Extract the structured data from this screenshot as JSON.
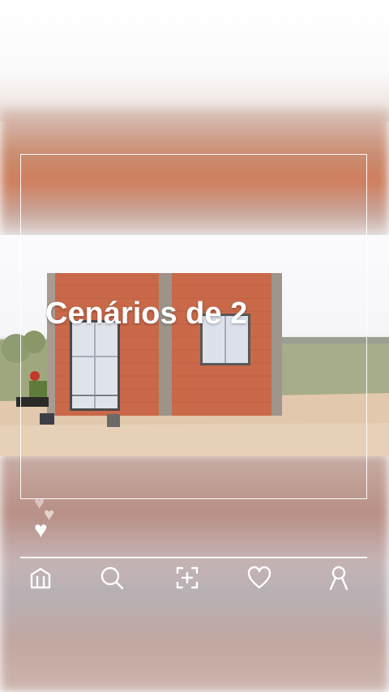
{
  "overlay": {
    "title": "Cenários de 2"
  },
  "reactions": {
    "heart_count_visible": 3
  },
  "nav": {
    "items": [
      {
        "name": "home",
        "icon": "home-icon"
      },
      {
        "name": "search",
        "icon": "search-icon"
      },
      {
        "name": "add",
        "icon": "add-media-icon"
      },
      {
        "name": "likes",
        "icon": "heart-icon"
      },
      {
        "name": "profile",
        "icon": "profile-icon"
      }
    ]
  },
  "colors": {
    "accent": "#ffffff",
    "brick": "#c9694a",
    "sky": "#f6f6f8"
  }
}
